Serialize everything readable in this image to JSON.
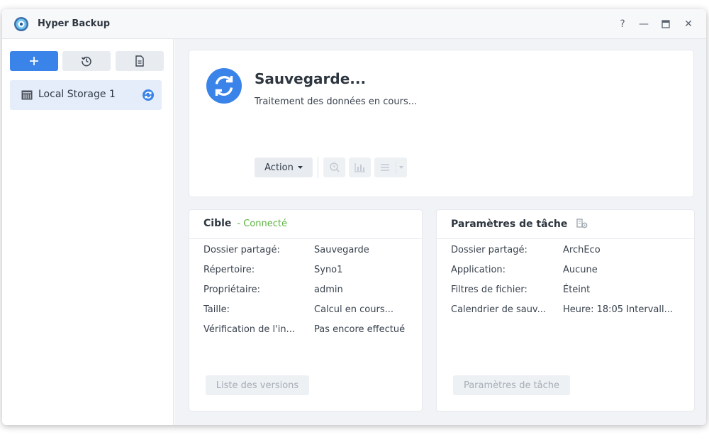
{
  "window": {
    "title": "Hyper Backup",
    "controls": {
      "help": "?",
      "minimize": "—",
      "maximize": "▭",
      "close": "✕"
    }
  },
  "sidebar": {
    "items": [
      {
        "label": "Local Storage 1",
        "icon": "storage-icon",
        "status_icon": "sync-icon"
      }
    ]
  },
  "status": {
    "title": "Sauvegarde...",
    "subtitle": "Traitement des données en cours...",
    "action_label": "Action"
  },
  "target": {
    "title": "Cible",
    "status": "- Connecté",
    "rows": [
      {
        "label": "Dossier partagé:",
        "value": "Sauvegarde"
      },
      {
        "label": "Répertoire:",
        "value": "Syno1"
      },
      {
        "label": "Propriétaire:",
        "value": "admin"
      },
      {
        "label": "Taille:",
        "value": "Calcul en cours..."
      },
      {
        "label": "Vérification de l'in...",
        "value": "Pas encore effectué"
      }
    ],
    "button_label": "Liste des versions"
  },
  "task": {
    "title": "Paramètres de tâche",
    "rows": [
      {
        "label": "Dossier partagé:",
        "value": "ArchEco"
      },
      {
        "label": "Application:",
        "value": "Aucune"
      },
      {
        "label": "Filtres de fichier:",
        "value": "Éteint"
      },
      {
        "label": "Calendrier de sauv...",
        "value": "Heure: 18:05 Intervall..."
      }
    ],
    "button_label": "Paramètres de tâche"
  },
  "colors": {
    "accent": "#3a84e9",
    "connected": "#5cb340"
  }
}
